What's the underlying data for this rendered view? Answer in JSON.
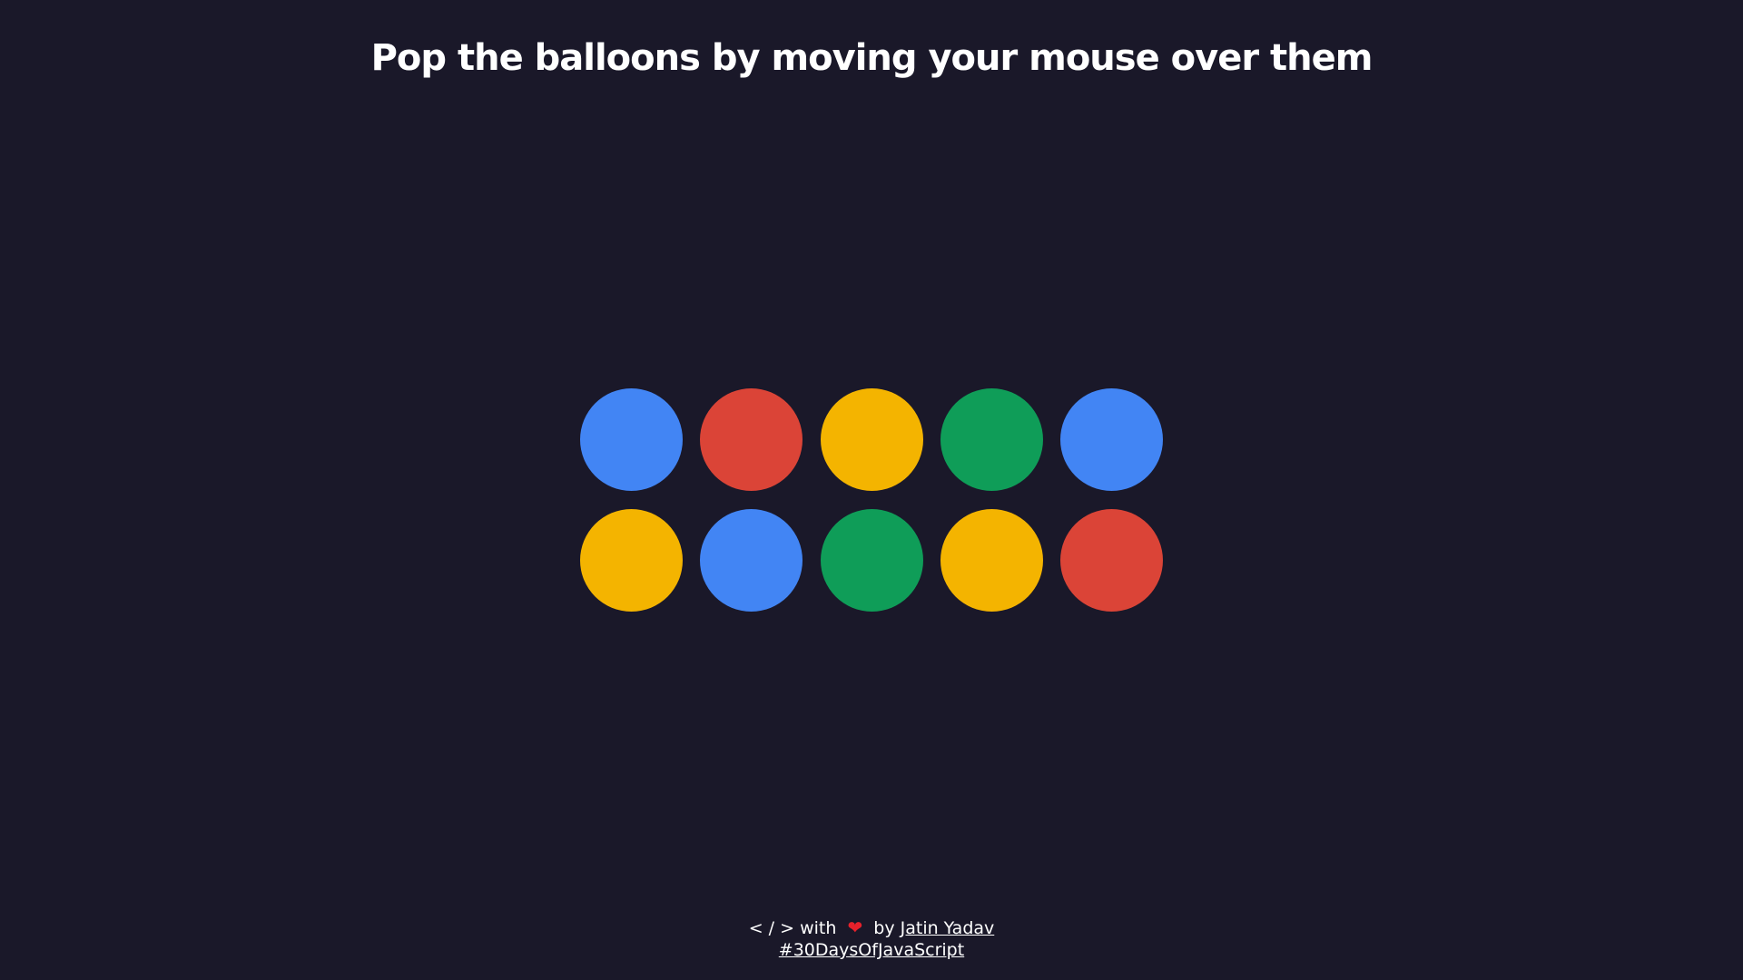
{
  "title": "Pop the balloons by moving your mouse over them",
  "balloons": [
    {
      "color": "#4285f4"
    },
    {
      "color": "#db4437"
    },
    {
      "color": "#f4b400"
    },
    {
      "color": "#0f9d58"
    },
    {
      "color": "#4285f4"
    },
    {
      "color": "#f4b400"
    },
    {
      "color": "#4285f4"
    },
    {
      "color": "#0f9d58"
    },
    {
      "color": "#f4b400"
    },
    {
      "color": "#db4437"
    }
  ],
  "footer": {
    "code_symbol": "< / >",
    "with_text": "with",
    "heart_icon": "heart-icon",
    "heart_glyph": "❤",
    "by_text": "by",
    "author": "Jatin Yadav",
    "hashtag": "#30DaysOfJavaScript"
  }
}
